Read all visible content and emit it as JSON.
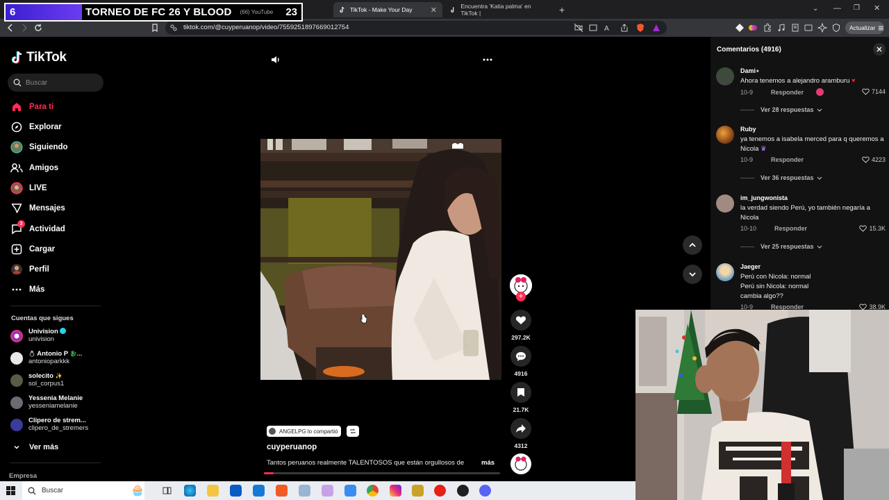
{
  "stream_banner": {
    "left_number": "6",
    "title": "TORNEO DE FC 26 Y BLOOD",
    "youtube_label": "(66) YouTube",
    "right_number": "23"
  },
  "browser": {
    "tabs": [
      {
        "label": "TikTok - Make Your Day",
        "active": true
      },
      {
        "label": "Encuentra 'Katia palma' en TikTok |",
        "active": false
      }
    ],
    "new_tab": "+",
    "url": "tiktok.com/@cuyperuanop/video/7559251897669012754",
    "update_button": "Actualizar"
  },
  "sidebar": {
    "logo": "TikTok",
    "search_placeholder": "Buscar",
    "nav": [
      {
        "label": "Para ti",
        "icon": "home-icon"
      },
      {
        "label": "Explorar",
        "icon": "compass-icon"
      },
      {
        "label": "Siguiendo",
        "icon": "following-avatar-icon"
      },
      {
        "label": "Amigos",
        "icon": "friends-icon"
      },
      {
        "label": "LIVE",
        "icon": "live-icon"
      },
      {
        "label": "Mensajes",
        "icon": "messages-icon"
      },
      {
        "label": "Actividad",
        "icon": "activity-icon",
        "badge": "3"
      },
      {
        "label": "Cargar",
        "icon": "upload-icon"
      },
      {
        "label": "Perfil",
        "icon": "profile-icon"
      },
      {
        "label": "Más",
        "icon": "more-icon"
      }
    ],
    "following_title": "Cuentas que sigues",
    "accounts": [
      {
        "name": "Univision",
        "handle": "univision",
        "verified": true
      },
      {
        "name": "Antonio P",
        "handle": "antonioparkkk"
      },
      {
        "name": "solecito",
        "handle": "sol_corpus1"
      },
      {
        "name": "Yessenia Melanie",
        "handle": "yesseniamelanie"
      },
      {
        "name": "Clipero de strem...",
        "handle": "clipero_de_stremers"
      }
    ],
    "see_more": "Ver más",
    "footer": "Empresa"
  },
  "video": {
    "shared_by": "ANGELPG lo compartió",
    "author": "cuyperuanop",
    "caption": "Tantos peruanos realmente TALENTOSOS que están orgullosos de",
    "more": "más",
    "progress": 0.04,
    "stats": {
      "likes": "297.2K",
      "comments": "4916",
      "saves": "21.7K",
      "shares": "4312"
    }
  },
  "comments": {
    "title": "Comentarios (4916)",
    "items": [
      {
        "user": "Dami⋆",
        "text": "Ahora tenemos a alejandro aramburu",
        "date": "10-9",
        "reply": "Responder",
        "likes": "7144",
        "replies": "Ver 28 respuestas"
      },
      {
        "user": "Ruby",
        "text": "ya tenemos a isabela merced para q queremos a Nicola",
        "date": "10-9",
        "reply": "Responder",
        "likes": "4223",
        "replies": "Ver 36 respuestas"
      },
      {
        "user": "im_jungwonista",
        "text": "la verdad siendo Perú, yo también negaría a Nicola",
        "date": "10-10",
        "reply": "Responder",
        "likes": "15.3K",
        "replies": "Ver 25 respuestas"
      },
      {
        "user": "Jaeger",
        "text": "Perú con Nicola: normal\nPerú sin Nicola: normal\ncambia algo??",
        "date": "10-9",
        "reply": "Responder",
        "likes": "38.9K"
      }
    ]
  },
  "taskbar": {
    "search_label": "Buscar"
  },
  "colors": {
    "tiktok_red": "#fe2c55",
    "banner_purple": "#4b28e0"
  }
}
